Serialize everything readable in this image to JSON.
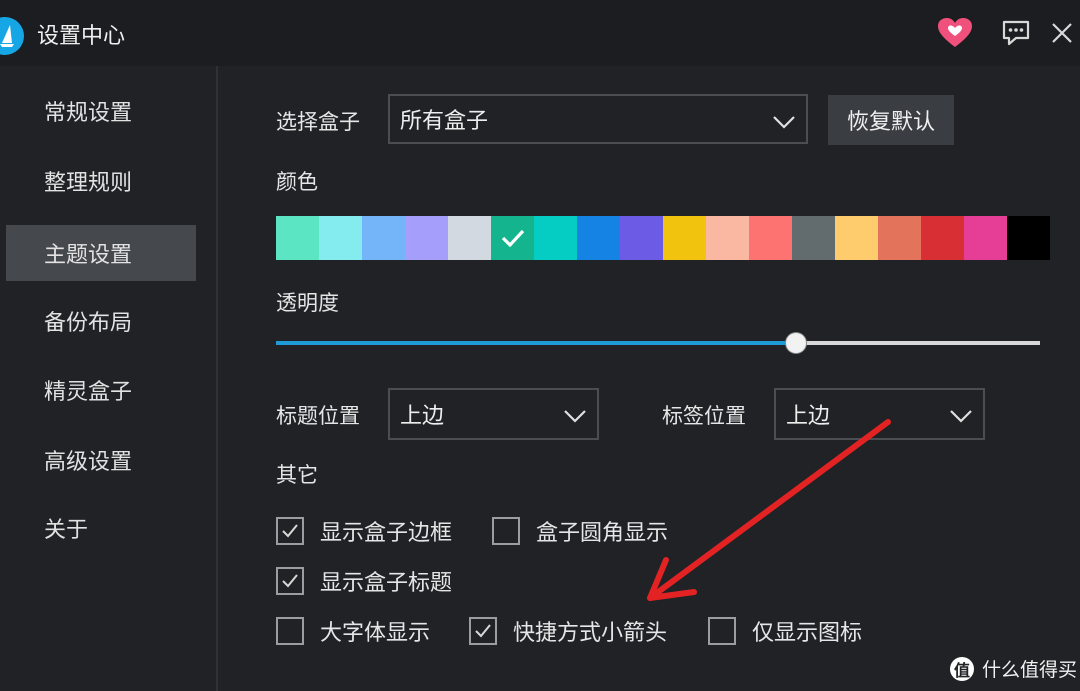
{
  "window": {
    "title": "设置中心"
  },
  "sidebar": {
    "items": [
      {
        "label": "常规设置"
      },
      {
        "label": "整理规则"
      },
      {
        "label": "主题设置",
        "active": true
      },
      {
        "label": "备份布局"
      },
      {
        "label": "精灵盒子"
      },
      {
        "label": "高级设置"
      },
      {
        "label": "关于"
      }
    ]
  },
  "theme": {
    "box_select_label": "选择盒子",
    "box_select_value": "所有盒子",
    "reset_button": "恢复默认",
    "color_label": "颜色",
    "colors": [
      "#5ce5c3",
      "#84ebee",
      "#74b5fa",
      "#a59ffb",
      "#d3d9e1",
      "#14b58e",
      "#06cdc4",
      "#1483e3",
      "#6c5be5",
      "#f1c30e",
      "#fab8a3",
      "#fd7372",
      "#626c6e",
      "#fecb6d",
      "#e3735a",
      "#d72f33",
      "#e63e96",
      "#000000"
    ],
    "selected_color_index": 5,
    "opacity_label": "透明度",
    "opacity_value": 0.68,
    "title_pos_label": "标题位置",
    "title_pos_value": "上边",
    "tag_pos_label": "标签位置",
    "tag_pos_value": "上边",
    "other_label": "其它"
  },
  "options": [
    {
      "label": "显示盒子边框",
      "checked": true
    },
    {
      "label": "盒子圆角显示",
      "checked": false
    },
    {
      "label": "显示盒子标题",
      "checked": true
    },
    {
      "label": "大字体显示",
      "checked": false
    },
    {
      "label": "快捷方式小箭头",
      "checked": true
    },
    {
      "label": "仅显示图标",
      "checked": false
    }
  ],
  "watermark": {
    "logo": "值",
    "text": "什么值得买"
  },
  "annotation": {
    "color": "#e32323"
  }
}
